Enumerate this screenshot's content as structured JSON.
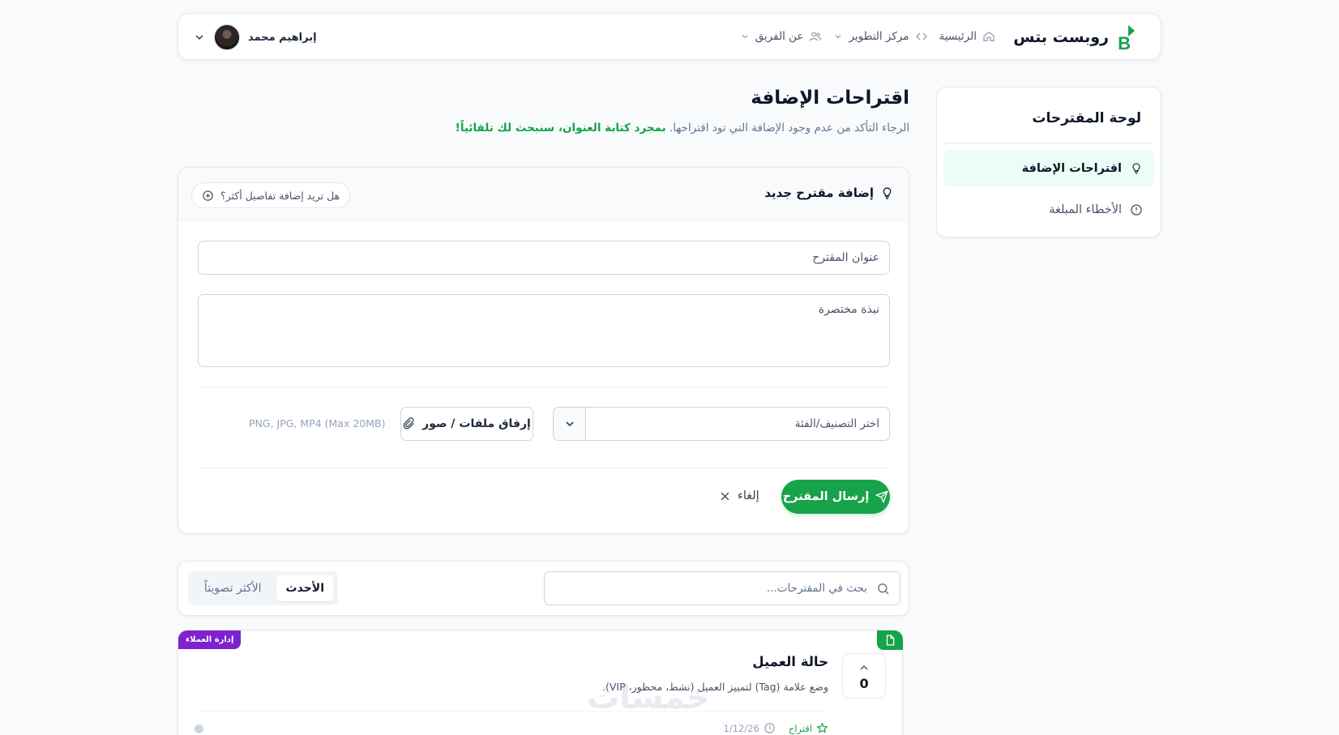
{
  "header": {
    "logo_text": "RB",
    "brand": "روبست بتس",
    "nav": [
      {
        "label": "الرئيسية",
        "icon": "home-icon"
      },
      {
        "label": "مركز التطوير",
        "icon": "code-icon"
      },
      {
        "label": "عن الفريق",
        "icon": "users-icon"
      }
    ],
    "user_name": "إبراهيم محمد"
  },
  "sidebar": {
    "title": "لوحة المقترحات",
    "items": [
      {
        "label": "اقتراحات الإضافة",
        "icon": "lightbulb-icon",
        "active": true
      },
      {
        "label": "الأخطاء المبلغة",
        "icon": "alert-circle-icon",
        "active": false
      }
    ]
  },
  "page": {
    "title": "اقتراحات الإضافة",
    "desc": "الرجاء التأكد من عدم وجود الإضافة التي تود اقتراحها.",
    "desc_highlight": "بمجرد كتابة العنوان، سنبحث لك تلقائياً!"
  },
  "form": {
    "heading": "إضافة مقترح جديد",
    "more_details": "هل تريد إضافة تفاصيل أكثر؟",
    "title_placeholder": "عنوان المقترح",
    "desc_placeholder": "نبذة مختصرة",
    "category_placeholder": "اختر التصنيف/الفئة",
    "attach_label": "إرفاق ملفات / صور",
    "attach_hint": "PNG, JPG, MP4 (Max 20MB)",
    "submit_label": "إرسال المقترح",
    "cancel_label": "إلغاء"
  },
  "list_controls": {
    "search_placeholder": "بحث في المقترحات...",
    "tabs": [
      {
        "label": "الأحدث",
        "active": true
      },
      {
        "label": "الأكثر تصويتاً",
        "active": false
      }
    ]
  },
  "suggestions": [
    {
      "category": "إدارة العملاء",
      "votes": "0",
      "title": "حالة العميل",
      "description": "وضع علامة (Tag) لتمييز العميل (نشط، محظور، VIP).",
      "type": "اقتراح",
      "date": "1/12/26"
    }
  ],
  "watermark": "خمسات",
  "colors": {
    "accent": "#16a34a",
    "accent_light": "#ecfdf5",
    "category_tag": "#7e22ce",
    "logo_blue": "#1e3a8a"
  }
}
